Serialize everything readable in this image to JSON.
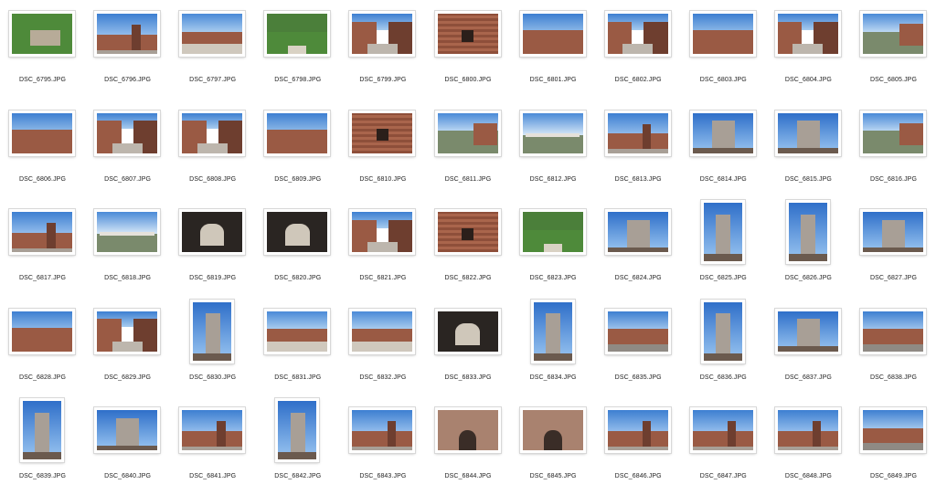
{
  "files": [
    {
      "name": "DSC_6795.JPG",
      "orientation": "landscape",
      "scene": "grass"
    },
    {
      "name": "DSC_6796.JPG",
      "orientation": "landscape",
      "scene": "castle-sky"
    },
    {
      "name": "DSC_6797.JPG",
      "orientation": "landscape",
      "scene": "courtyard"
    },
    {
      "name": "DSC_6798.JPG",
      "orientation": "landscape",
      "scene": "park"
    },
    {
      "name": "DSC_6799.JPG",
      "orientation": "landscape",
      "scene": "walkway"
    },
    {
      "name": "DSC_6800.JPG",
      "orientation": "landscape",
      "scene": "brick"
    },
    {
      "name": "DSC_6801.JPG",
      "orientation": "landscape",
      "scene": "battlement"
    },
    {
      "name": "DSC_6802.JPG",
      "orientation": "landscape",
      "scene": "walkway"
    },
    {
      "name": "DSC_6803.JPG",
      "orientation": "landscape",
      "scene": "battlement"
    },
    {
      "name": "DSC_6804.JPG",
      "orientation": "landscape",
      "scene": "walkway"
    },
    {
      "name": "DSC_6805.JPG",
      "orientation": "landscape",
      "scene": "river"
    },
    {
      "name": "DSC_6806.JPG",
      "orientation": "landscape",
      "scene": "battlement"
    },
    {
      "name": "DSC_6807.JPG",
      "orientation": "landscape",
      "scene": "walkway"
    },
    {
      "name": "DSC_6808.JPG",
      "orientation": "landscape",
      "scene": "walkway"
    },
    {
      "name": "DSC_6809.JPG",
      "orientation": "landscape",
      "scene": "battlement"
    },
    {
      "name": "DSC_6810.JPG",
      "orientation": "landscape",
      "scene": "brick"
    },
    {
      "name": "DSC_6811.JPG",
      "orientation": "landscape",
      "scene": "river"
    },
    {
      "name": "DSC_6812.JPG",
      "orientation": "landscape",
      "scene": "bridge"
    },
    {
      "name": "DSC_6813.JPG",
      "orientation": "landscape",
      "scene": "castle-sky"
    },
    {
      "name": "DSC_6814.JPG",
      "orientation": "landscape",
      "scene": "tower"
    },
    {
      "name": "DSC_6815.JPG",
      "orientation": "landscape",
      "scene": "tower"
    },
    {
      "name": "DSC_6816.JPG",
      "orientation": "landscape",
      "scene": "river"
    },
    {
      "name": "DSC_6817.JPG",
      "orientation": "landscape",
      "scene": "castle-sky"
    },
    {
      "name": "DSC_6818.JPG",
      "orientation": "landscape",
      "scene": "bridge"
    },
    {
      "name": "DSC_6819.JPG",
      "orientation": "landscape",
      "scene": "arch-dark"
    },
    {
      "name": "DSC_6820.JPG",
      "orientation": "landscape",
      "scene": "arch-dark"
    },
    {
      "name": "DSC_6821.JPG",
      "orientation": "landscape",
      "scene": "walkway"
    },
    {
      "name": "DSC_6822.JPG",
      "orientation": "landscape",
      "scene": "brick"
    },
    {
      "name": "DSC_6823.JPG",
      "orientation": "landscape",
      "scene": "park"
    },
    {
      "name": "DSC_6824.JPG",
      "orientation": "landscape",
      "scene": "tower"
    },
    {
      "name": "DSC_6825.JPG",
      "orientation": "portrait",
      "scene": "tower"
    },
    {
      "name": "DSC_6826.JPG",
      "orientation": "portrait",
      "scene": "tower"
    },
    {
      "name": "DSC_6827.JPG",
      "orientation": "landscape",
      "scene": "tower"
    },
    {
      "name": "DSC_6828.JPG",
      "orientation": "landscape",
      "scene": "battlement"
    },
    {
      "name": "DSC_6829.JPG",
      "orientation": "landscape",
      "scene": "walkway"
    },
    {
      "name": "DSC_6830.JPG",
      "orientation": "portrait",
      "scene": "tower"
    },
    {
      "name": "DSC_6831.JPG",
      "orientation": "landscape",
      "scene": "courtyard"
    },
    {
      "name": "DSC_6832.JPG",
      "orientation": "landscape",
      "scene": "courtyard"
    },
    {
      "name": "DSC_6833.JPG",
      "orientation": "landscape",
      "scene": "arch-dark"
    },
    {
      "name": "DSC_6834.JPG",
      "orientation": "portrait",
      "scene": "tower"
    },
    {
      "name": "DSC_6835.JPG",
      "orientation": "landscape",
      "scene": "street"
    },
    {
      "name": "DSC_6836.JPG",
      "orientation": "portrait",
      "scene": "tower"
    },
    {
      "name": "DSC_6837.JPG",
      "orientation": "landscape",
      "scene": "tower"
    },
    {
      "name": "DSC_6838.JPG",
      "orientation": "landscape",
      "scene": "street"
    },
    {
      "name": "DSC_6839.JPG",
      "orientation": "portrait",
      "scene": "tower"
    },
    {
      "name": "DSC_6840.JPG",
      "orientation": "landscape",
      "scene": "tower"
    },
    {
      "name": "DSC_6841.JPG",
      "orientation": "landscape",
      "scene": "castle-sky"
    },
    {
      "name": "DSC_6842.JPG",
      "orientation": "portrait",
      "scene": "tower"
    },
    {
      "name": "DSC_6843.JPG",
      "orientation": "landscape",
      "scene": "castle-sky"
    },
    {
      "name": "DSC_6844.JPG",
      "orientation": "landscape",
      "scene": "gate"
    },
    {
      "name": "DSC_6845.JPG",
      "orientation": "landscape",
      "scene": "gate"
    },
    {
      "name": "DSC_6846.JPG",
      "orientation": "landscape",
      "scene": "castle-sky"
    },
    {
      "name": "DSC_6847.JPG",
      "orientation": "landscape",
      "scene": "castle-sky"
    },
    {
      "name": "DSC_6848.JPG",
      "orientation": "landscape",
      "scene": "castle-sky"
    },
    {
      "name": "DSC_6849.JPG",
      "orientation": "landscape",
      "scene": "street"
    }
  ],
  "colors": {
    "sky": "#4f8fd9",
    "brick": "#9a5a44",
    "brickDark": "#6e3e2f",
    "stone": "#a89f96",
    "grass": "#4e8a3a",
    "water": "#7a8a6c",
    "shadow": "#2a2522",
    "label": "#222222"
  }
}
